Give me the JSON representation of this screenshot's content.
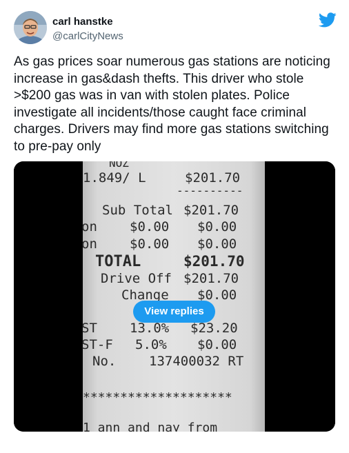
{
  "author": {
    "name": "carl hanstke",
    "handle": "@carlCityNews"
  },
  "icons": {
    "logo": "twitter-bird-icon",
    "avatar": "profile-photo"
  },
  "colors": {
    "brand": "#1d9bf0",
    "text": "#0f1419",
    "secondary": "#536471"
  },
  "tweet": {
    "text": "As gas prices soar numerous gas stations are noticing increase in gas&dash thefts. This driver who stole >$200 gas was in van with stolen plates. Police investigate all incidents/those caught face criminal charges. Drivers may find more gas stations switching to pre-pay only"
  },
  "receipt": {
    "header_cut": "NOZ",
    "price_line": "1.849/ L",
    "price_amount": "$201.70",
    "dashes": "----------",
    "subtotal_label": "Sub Total",
    "subtotal_amount": "$201.70",
    "row1_left": "on",
    "row1_mid": "$0.00",
    "row1_right": "$0.00",
    "row2_left": "on",
    "row2_mid": "$0.00",
    "row2_right": "$0.00",
    "total_label": "TOTAL",
    "total_amount": "$201.70",
    "driveoff_label": "Drive Off",
    "driveoff_amount": "$201.70",
    "change_label": "Change",
    "change_amount": "$0.00",
    "gst_left": "ST",
    "gst_rate": "13.0%",
    "gst_amount": "$23.20",
    "gstf_left": "ST-F",
    "gstf_rate": "5.0%",
    "gstf_amount": "$0.00",
    "no_label": "No.",
    "no_value": "137400032 RT",
    "stars": "********************",
    "bottom_cut": "1 ann and nay from"
  },
  "media": {
    "replies_button": "View replies"
  }
}
